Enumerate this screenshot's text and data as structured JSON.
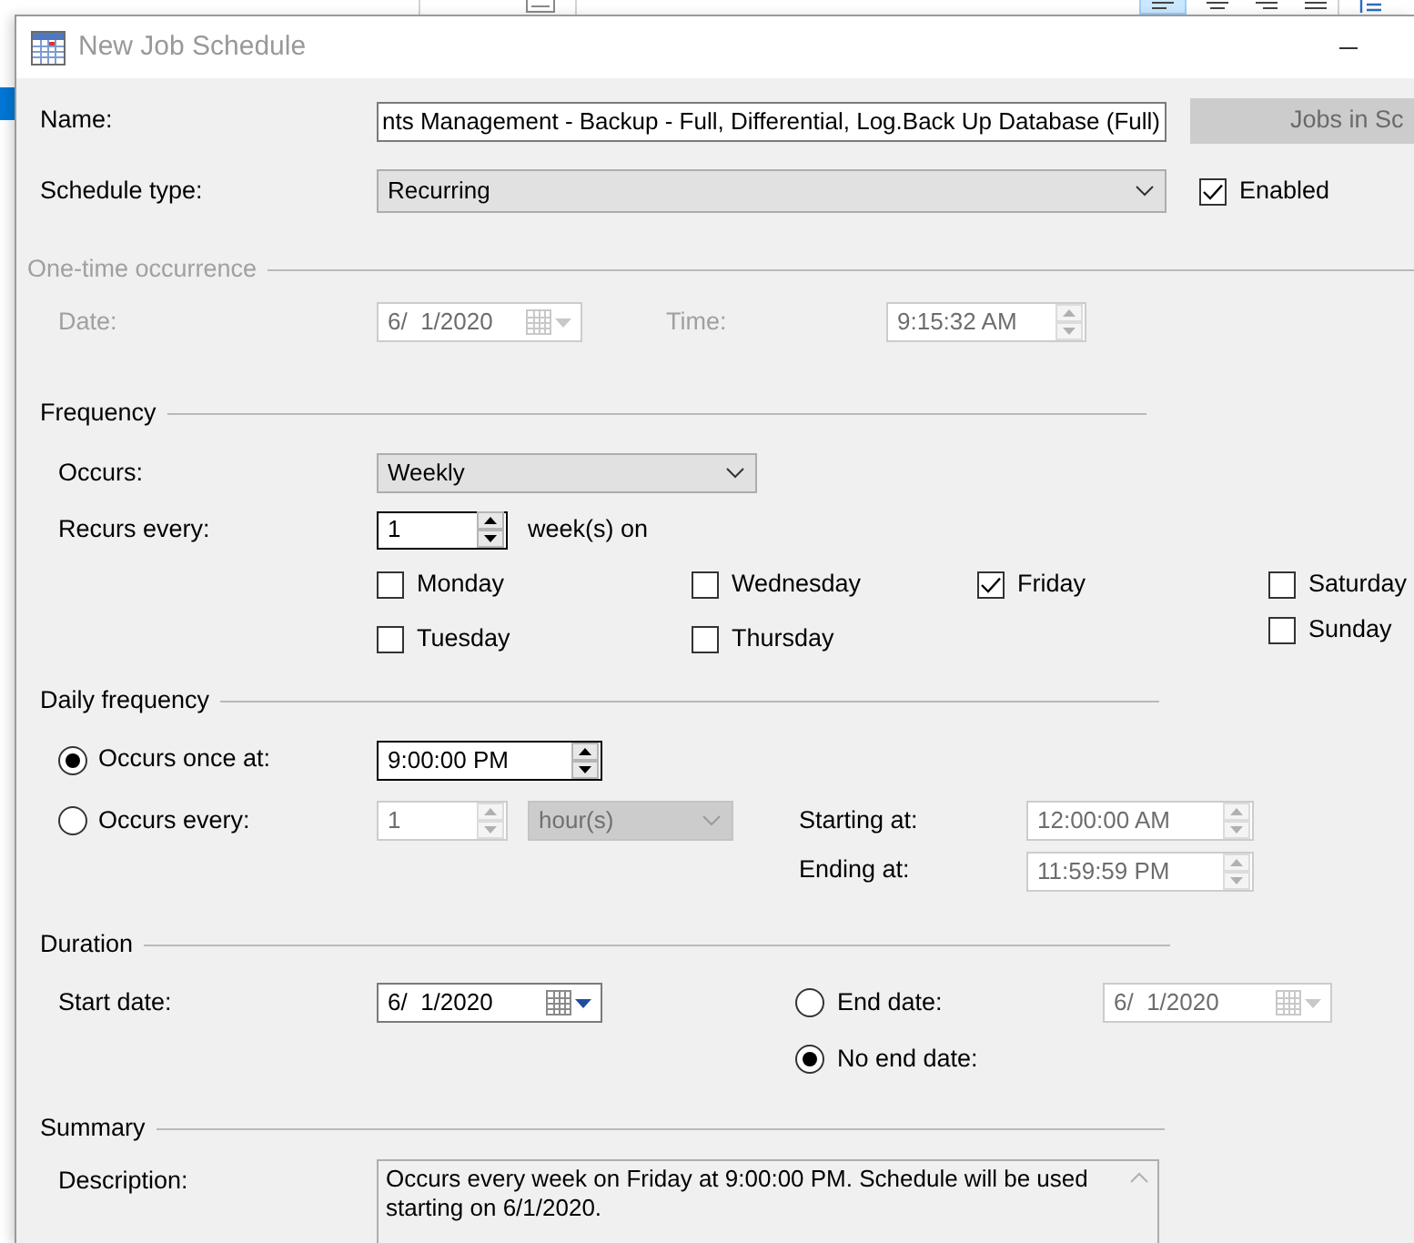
{
  "window": {
    "title": "New Job Schedule"
  },
  "name": {
    "label": "Name:",
    "value": "nts Management - Backup - Full, Differential, Log.Back Up Database (Full)"
  },
  "jobs_button": {
    "label": "Jobs in Sc",
    "disabled": true
  },
  "schedule_type": {
    "label": "Schedule type:",
    "value": "Recurring"
  },
  "enabled": {
    "label": "Enabled",
    "checked": true
  },
  "one_time_occurrence": {
    "title": "One-time occurrence",
    "disabled": true,
    "date": {
      "label": "Date:",
      "value": "6/  1/2020"
    },
    "time": {
      "label": "Time:",
      "value": "9:15:32 AM"
    }
  },
  "frequency": {
    "title": "Frequency",
    "occurs": {
      "label": "Occurs:",
      "value": "Weekly"
    },
    "recurs_every": {
      "label": "Recurs every:",
      "value": "1",
      "unit": "week(s) on"
    },
    "days": [
      {
        "label": "Monday",
        "checked": false
      },
      {
        "label": "Tuesday",
        "checked": false
      },
      {
        "label": "Wednesday",
        "checked": false
      },
      {
        "label": "Thursday",
        "checked": false
      },
      {
        "label": "Friday",
        "checked": true
      },
      {
        "label": "Saturday",
        "checked": false
      },
      {
        "label": "Sunday",
        "checked": false
      }
    ]
  },
  "daily_frequency": {
    "title": "Daily frequency",
    "options": [
      {
        "label": "Occurs once at:",
        "selected": true,
        "value": "9:00:00 PM"
      },
      {
        "label": "Occurs every:",
        "selected": false,
        "value": "1",
        "unit": "hour(s)"
      }
    ],
    "starting_at": {
      "label": "Starting at:",
      "value": "12:00:00 AM"
    },
    "ending_at": {
      "label": "Ending at:",
      "value": "11:59:59 PM"
    }
  },
  "duration": {
    "title": "Duration",
    "start_date": {
      "label": "Start date:",
      "value": "6/  1/2020"
    },
    "end_options": [
      {
        "label": "End date:",
        "selected": false,
        "value": "6/  1/2020"
      },
      {
        "label": "No end date:",
        "selected": true
      }
    ]
  },
  "summary": {
    "title": "Summary",
    "description": {
      "label": "Description:",
      "value": "Occurs every week on Friday at 9:00:00 PM. Schedule will be used starting on 6/1/2020."
    }
  }
}
